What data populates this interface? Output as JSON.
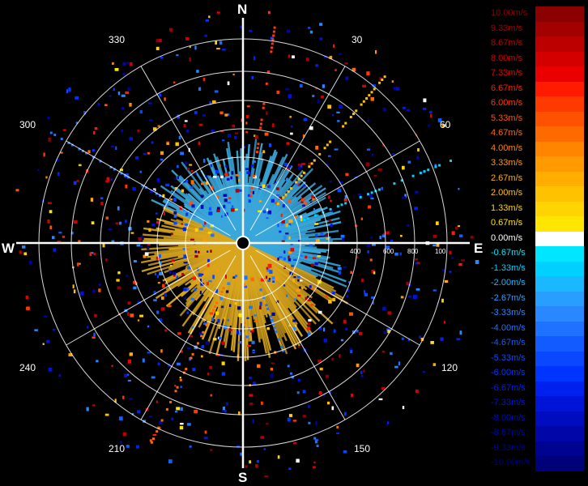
{
  "compass": {
    "north": "N",
    "south": "S",
    "east": "E",
    "west": "W"
  },
  "bearing_labels": {
    "b30": "30",
    "b60": "60",
    "b120": "120",
    "b150": "150",
    "b210": "210",
    "b240": "240",
    "b300": "300",
    "b330": "330"
  },
  "range_labels": [
    "400",
    "600",
    "800",
    "100"
  ],
  "legend": {
    "items": [
      {
        "label": "10.00m/s",
        "color": "#8b0000"
      },
      {
        "label": "9.33m/s",
        "color": "#a30000"
      },
      {
        "label": "8.67m/s",
        "color": "#bc0000"
      },
      {
        "label": "8.00m/s",
        "color": "#d40000"
      },
      {
        "label": "7.33m/s",
        "color": "#ea0000"
      },
      {
        "label": "6.67m/s",
        "color": "#ff1a00"
      },
      {
        "label": "6.00m/s",
        "color": "#ff3a00"
      },
      {
        "label": "5.33m/s",
        "color": "#ff5200"
      },
      {
        "label": "4.67m/s",
        "color": "#ff6a00"
      },
      {
        "label": "4.00m/s",
        "color": "#ff8400"
      },
      {
        "label": "3.33m/s",
        "color": "#ff9a00"
      },
      {
        "label": "2.67m/s",
        "color": "#ffae00"
      },
      {
        "label": "2.00m/s",
        "color": "#ffc200"
      },
      {
        "label": "1.33m/s",
        "color": "#ffd400"
      },
      {
        "label": "0.67m/s",
        "color": "#ffe600"
      },
      {
        "label": "0.00m/s",
        "color": "#ffffff"
      },
      {
        "label": "-0.67m/s",
        "color": "#00e6ff"
      },
      {
        "label": "-1.33m/s",
        "color": "#00d0ff"
      },
      {
        "label": "-2.00m/s",
        "color": "#1ab8ff"
      },
      {
        "label": "-2.67m/s",
        "color": "#289fff"
      },
      {
        "label": "-3.33m/s",
        "color": "#2a88ff"
      },
      {
        "label": "-4.00m/s",
        "color": "#1e72ff"
      },
      {
        "label": "-4.67m/s",
        "color": "#125cff"
      },
      {
        "label": "-5.33m/s",
        "color": "#0a48ff"
      },
      {
        "label": "-6.00m/s",
        "color": "#0034ff"
      },
      {
        "label": "-6.67m/s",
        "color": "#0020f0"
      },
      {
        "label": "-7.33m/s",
        "color": "#0014d8"
      },
      {
        "label": "-8.00m/s",
        "color": "#000cc0"
      },
      {
        "label": "-8.67m/s",
        "color": "#0006a8"
      },
      {
        "label": "-9.33m/s",
        "color": "#000290"
      },
      {
        "label": "-10.00m/s",
        "color": "#000078"
      }
    ]
  },
  "colors": {
    "approach": "#3aa8dc",
    "recede": "#d9a61e",
    "grid": "#ffffff"
  }
}
